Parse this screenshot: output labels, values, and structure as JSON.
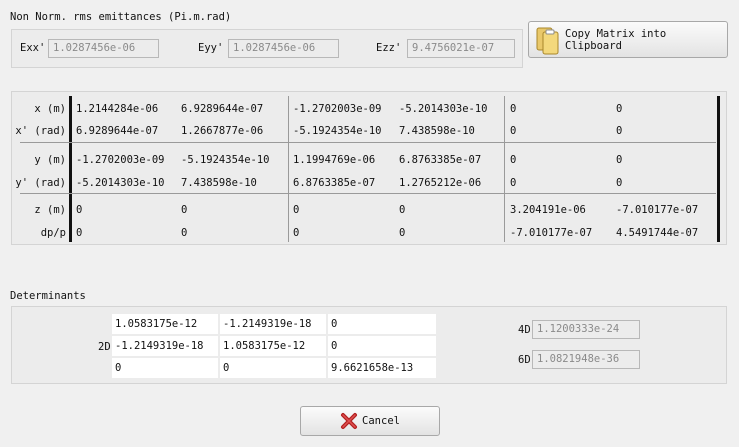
{
  "emittances": {
    "title": "Non Norm. rms emittances (Pi.m.rad)",
    "exx_label": "Exx'",
    "exx_value": "1.0287456e-06",
    "eyy_label": "Eyy'",
    "eyy_value": "1.0287456e-06",
    "ezz_label": "Ezz'",
    "ezz_value": "9.4756021e-07"
  },
  "copy_button": {
    "label": "Copy Matrix into Clipboard",
    "icon": "clipboard-icon"
  },
  "matrix": {
    "row_labels": [
      "x (m)",
      "x' (rad)",
      "y (m)",
      "y' (rad)",
      "z (m)",
      "dp/p"
    ],
    "rows": [
      [
        "1.2144284e-06",
        "6.9289644e-07",
        "-1.2702003e-09",
        "-5.2014303e-10",
        "0",
        "0"
      ],
      [
        "6.9289644e-07",
        "1.2667877e-06",
        "-5.1924354e-10",
        "7.438598e-10",
        "0",
        "0"
      ],
      [
        "-1.2702003e-09",
        "-5.1924354e-10",
        "1.1994769e-06",
        "6.8763385e-07",
        "0",
        "0"
      ],
      [
        "-5.2014303e-10",
        "7.438598e-10",
        "6.8763385e-07",
        "1.2765212e-06",
        "0",
        "0"
      ],
      [
        "0",
        "0",
        "0",
        "0",
        "3.204191e-06",
        "-7.010177e-07"
      ],
      [
        "0",
        "0",
        "0",
        "0",
        "-7.010177e-07",
        "4.5491744e-07"
      ]
    ]
  },
  "determinants": {
    "title": "Determinants",
    "label_2d": "2D",
    "matrix": [
      [
        "1.0583175e-12",
        "-1.2149319e-18",
        "0"
      ],
      [
        "-1.2149319e-18",
        "1.0583175e-12",
        "0"
      ],
      [
        "0",
        "0",
        "9.6621658e-13"
      ]
    ],
    "label_4d": "4D",
    "value_4d": "1.1200333e-24",
    "label_6d": "6D",
    "value_6d": "1.0821948e-36"
  },
  "cancel_button": {
    "label": "Cancel",
    "icon": "cancel-x-icon"
  }
}
